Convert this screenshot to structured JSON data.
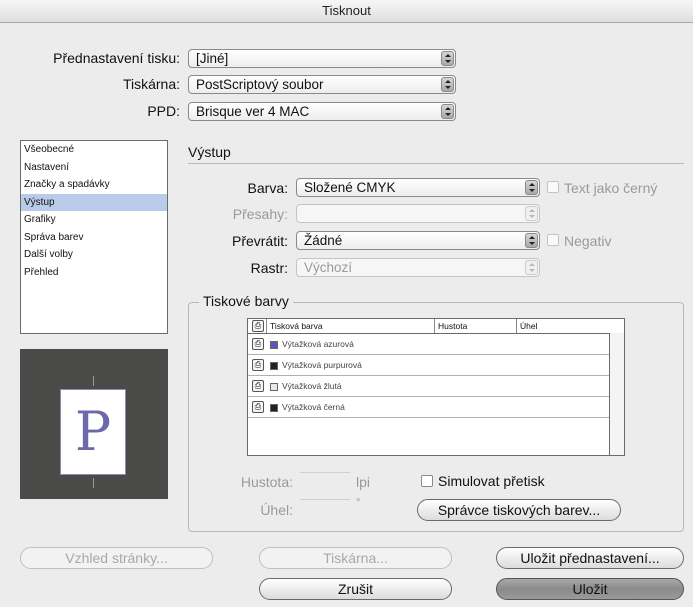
{
  "window": {
    "title": "Tisknout"
  },
  "top": {
    "preset_label": "Přednastavení tisku:",
    "preset_value": "[Jiné]",
    "printer_label": "Tiskárna:",
    "printer_value": "PostScriptový soubor",
    "ppd_label": "PPD:",
    "ppd_value": "Brisque ver 4 MAC"
  },
  "sidebar": {
    "items": [
      {
        "label": "Všeobecné",
        "selected": false
      },
      {
        "label": "Nastavení",
        "selected": false
      },
      {
        "label": "Značky a spadávky",
        "selected": false
      },
      {
        "label": "Výstup",
        "selected": true
      },
      {
        "label": "Grafiky",
        "selected": false
      },
      {
        "label": "Správa barev",
        "selected": false
      },
      {
        "label": "Další volby",
        "selected": false
      },
      {
        "label": "Přehled",
        "selected": false
      }
    ],
    "preview_letter": "P"
  },
  "output": {
    "section_title": "Výstup",
    "color_label": "Barva:",
    "color_value": "Složené CMYK",
    "text_black_label": "Text jako černý",
    "trapping_label": "Přesahy:",
    "trapping_value": "",
    "flip_label": "Převrátit:",
    "flip_value": "Žádné",
    "negative_label": "Negativ",
    "screening_label": "Rastr:",
    "screening_value": "Výchozí"
  },
  "inks": {
    "group_title": "Tiskové barvy",
    "columns": [
      "Tisková barva",
      "Hustota",
      "Úhel"
    ],
    "rows": [
      {
        "name": "Výtažková azurová",
        "swatch": "#5a56b8"
      },
      {
        "name": "Výtažková purpurová",
        "swatch": "#222222"
      },
      {
        "name": "Výtažková žlutá",
        "swatch": "#e8e8e8"
      },
      {
        "name": "Výtažková černá",
        "swatch": "#222222"
      }
    ],
    "frequency_label": "Hustota:",
    "frequency_unit": "lpi",
    "angle_label": "Úhel:",
    "angle_unit": "°",
    "simulate_overprint_label": "Simulovat přetisk",
    "ink_manager_label": "Správce tiskových barev..."
  },
  "buttons": {
    "page_setup": "Vzhled stránky...",
    "printer": "Tiskárna...",
    "save_preset": "Uložit přednastavení...",
    "cancel": "Zrušit",
    "save": "Uložit"
  }
}
